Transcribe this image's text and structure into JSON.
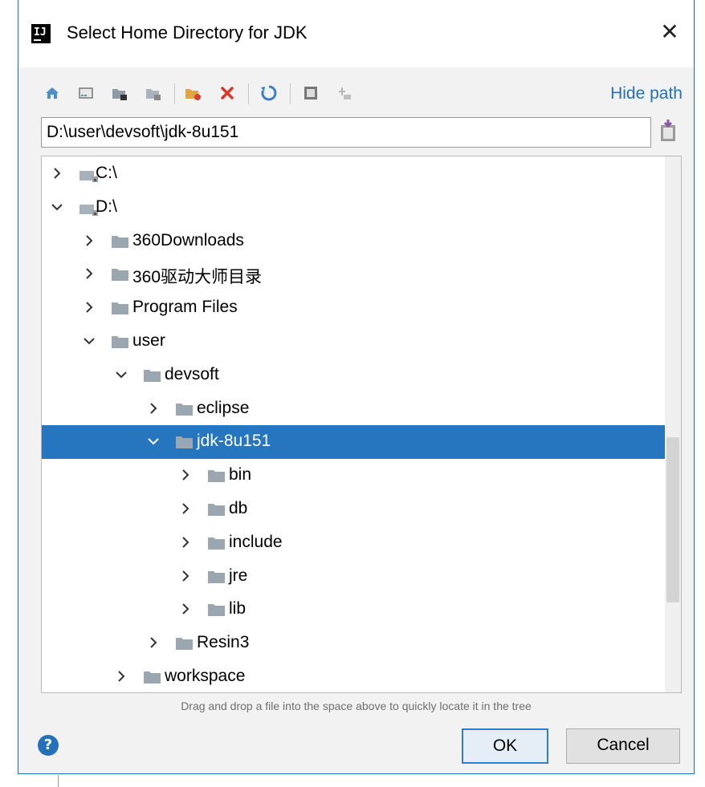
{
  "window": {
    "title": "Select Home Directory for JDK",
    "close_glyph": "✕"
  },
  "toolbar": {
    "hide_path_label": "Hide path",
    "icons": [
      "home-icon",
      "desktop-icon",
      "project-icon",
      "module-icon",
      "new-folder-icon",
      "delete-icon",
      "refresh-icon",
      "show-hidden-icon",
      "link-icon"
    ]
  },
  "path": {
    "value": "D:\\user\\devsoft\\jdk-8u151"
  },
  "tree": {
    "rows": [
      {
        "label": "C:\\",
        "depth": 0,
        "expanded": false,
        "type": "drive"
      },
      {
        "label": "D:\\",
        "depth": 0,
        "expanded": true,
        "type": "drive"
      },
      {
        "label": "360Downloads",
        "depth": 1,
        "expanded": false,
        "type": "folder"
      },
      {
        "label": "360驱动大师目录",
        "depth": 1,
        "expanded": false,
        "type": "folder"
      },
      {
        "label": "Program Files",
        "depth": 1,
        "expanded": false,
        "type": "folder"
      },
      {
        "label": "user",
        "depth": 1,
        "expanded": true,
        "type": "folder"
      },
      {
        "label": "devsoft",
        "depth": 2,
        "expanded": true,
        "type": "folder"
      },
      {
        "label": "eclipse",
        "depth": 3,
        "expanded": false,
        "type": "folder"
      },
      {
        "label": "jdk-8u151",
        "depth": 3,
        "expanded": true,
        "type": "folder",
        "selected": true
      },
      {
        "label": "bin",
        "depth": 4,
        "expanded": false,
        "type": "folder"
      },
      {
        "label": "db",
        "depth": 4,
        "expanded": false,
        "type": "folder"
      },
      {
        "label": "include",
        "depth": 4,
        "expanded": false,
        "type": "folder"
      },
      {
        "label": "jre",
        "depth": 4,
        "expanded": false,
        "type": "folder"
      },
      {
        "label": "lib",
        "depth": 4,
        "expanded": false,
        "type": "folder"
      },
      {
        "label": "Resin3",
        "depth": 3,
        "expanded": false,
        "type": "folder"
      },
      {
        "label": "workspace",
        "depth": 2,
        "expanded": false,
        "type": "folder"
      }
    ]
  },
  "hint": "Drag and drop a file into the space above to quickly locate it in the tree",
  "buttons": {
    "help": "?",
    "ok": "OK",
    "cancel": "Cancel"
  },
  "colors": {
    "selection": "#2675bf",
    "link": "#2470b3",
    "folder": "#9aa7b1"
  }
}
